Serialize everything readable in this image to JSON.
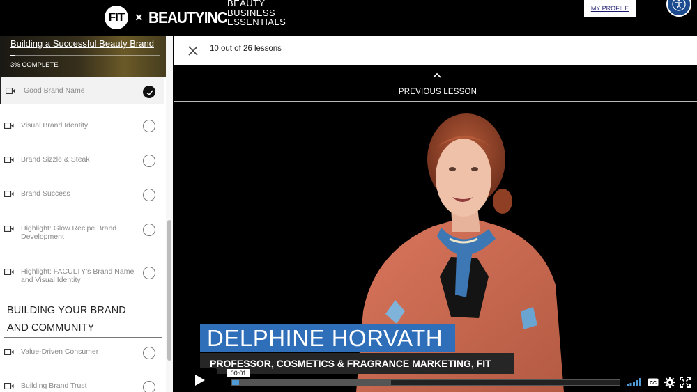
{
  "header": {
    "logo_mark": "FIT",
    "logo_times": "×",
    "logo_brand": "BEAUTYINC",
    "logo_tagline": [
      "BEAUTY",
      "BUSINESS",
      "ESSENTIALS"
    ],
    "profile_label": "MY PROFILE"
  },
  "sidebar": {
    "course_title": "Building a Successful Beauty Brand",
    "progress_label": "3% COMPLETE",
    "progress_fraction": 0.03,
    "lessons": [
      {
        "label": "Good Brand Name",
        "completed": true,
        "active": true
      },
      {
        "label": "Visual Brand Identity",
        "completed": false
      },
      {
        "label": "Brand Sizzle & Steak",
        "completed": false
      },
      {
        "label": "Brand Success",
        "completed": false
      },
      {
        "label": "Highlight: Glow Recipe Brand Development",
        "completed": false
      },
      {
        "label": "Highlight: FACULTY's Brand Name and Visual Identity",
        "completed": false
      }
    ],
    "section_title": "BUILDING YOUR BRAND AND COMMUNITY",
    "section_lessons": [
      {
        "label": "Value-Driven Consumer",
        "completed": false
      },
      {
        "label": "Building Brand Trust",
        "completed": false
      }
    ]
  },
  "main": {
    "lesson_count": "10 out of 26 lessons",
    "previous_label": "PREVIOUS LESSON",
    "speaker_name": "DELPHINE HORVATH",
    "speaker_title": "PROFESSOR, COSMETICS & FRAGRANCE MARKETING, FIT"
  },
  "player": {
    "current_time": "00:01",
    "progress_fraction": 0.018,
    "buffered_fraction": 0.41
  },
  "colors": {
    "accent_blue": "#2f6fb9",
    "progress_blue": "#4e9bd8",
    "accessibility_blue": "#1d4b8f"
  }
}
